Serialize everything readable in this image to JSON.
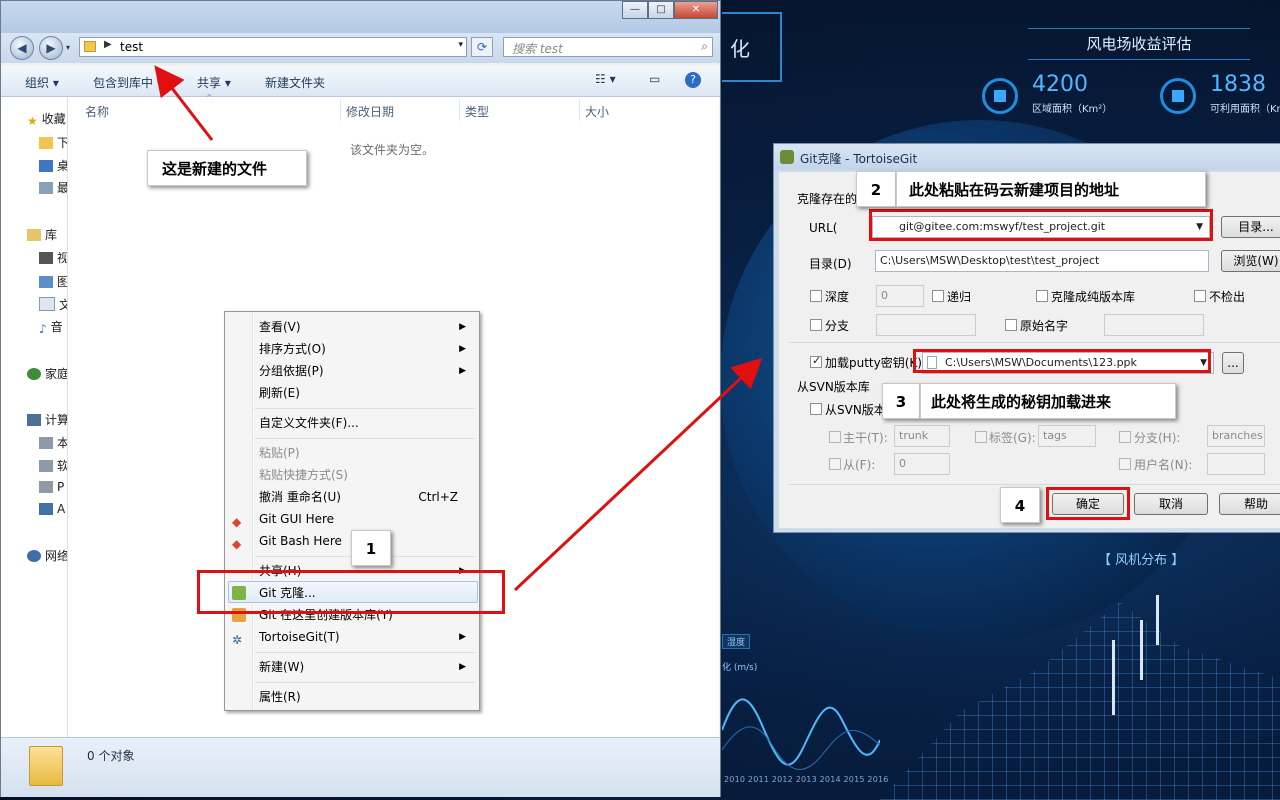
{
  "dashboard": {
    "title": "风电场收益评估",
    "hex_text": "化",
    "stats": [
      {
        "value": "4200",
        "label": "区域面积（Km²）"
      },
      {
        "value": "1838",
        "label": "可利用面积（Km"
      }
    ],
    "fan_label": "【 风机分布 】",
    "wave_tag": "湿度",
    "wave_sub": "化 (m/s)",
    "years": "2010  2011  2012  2013  2014  2015  2016"
  },
  "explorer": {
    "window_buttons": [
      "—",
      "□",
      "✕"
    ],
    "address_crumb": "test",
    "search_placeholder": "搜索 test",
    "toolbar": [
      "组织 ▾",
      "包含到库中 ▾",
      "共享 ▾",
      "新建文件夹"
    ],
    "sidebar": [
      {
        "label": "收藏",
        "icon": "star-icon"
      },
      {
        "label": "下",
        "icon": "download-icon"
      },
      {
        "label": "桌",
        "icon": "desktop-icon"
      },
      {
        "label": "最",
        "icon": "recent-icon"
      },
      {
        "label": "库",
        "icon": "library-icon"
      },
      {
        "label": "视",
        "icon": "video-icon"
      },
      {
        "label": "图",
        "icon": "picture-icon"
      },
      {
        "label": "文",
        "icon": "document-icon"
      },
      {
        "label": "音",
        "icon": "music-icon"
      },
      {
        "label": "家庭",
        "icon": "homegroup-icon"
      },
      {
        "label": "计算",
        "icon": "computer-icon"
      },
      {
        "label": "本",
        "icon": "drive-icon"
      },
      {
        "label": "软",
        "icon": "drive-icon"
      },
      {
        "label": "P",
        "icon": "drive-icon"
      },
      {
        "label": "A",
        "icon": "drive-icon"
      },
      {
        "label": "网络",
        "icon": "network-icon"
      }
    ],
    "columns": [
      "名称",
      "修改日期",
      "类型",
      "大小"
    ],
    "empty_text": "该文件夹为空。",
    "status": "0 个对象"
  },
  "context_menu": {
    "items": [
      {
        "label": "查看(V)",
        "submenu": true
      },
      {
        "label": "排序方式(O)",
        "submenu": true
      },
      {
        "label": "分组依据(P)",
        "submenu": true
      },
      {
        "label": "刷新(E)"
      },
      {
        "label": "自定义文件夹(F)..."
      },
      {
        "label": "粘贴(P)",
        "disabled": true
      },
      {
        "label": "粘贴快捷方式(S)",
        "disabled": true
      },
      {
        "label": "撤消 重命名(U)",
        "shortcut": "Ctrl+Z"
      },
      {
        "label": "Git GUI Here",
        "icon": "git-icon"
      },
      {
        "label": "Git Bash Here",
        "icon": "git-icon"
      },
      {
        "label": "共享(H)",
        "submenu": true
      },
      {
        "label": "Git 克隆...",
        "icon": "git-clone-icon"
      },
      {
        "label": "Git 在这里创建版本库(Y)",
        "icon": "git-repo-icon"
      },
      {
        "label": "TortoiseGit(T)",
        "icon": "tortoise-icon",
        "submenu": true
      },
      {
        "label": "新建(W)",
        "submenu": true
      },
      {
        "label": "属性(R)"
      }
    ]
  },
  "git_dialog": {
    "title": "Git克隆 - TortoiseGit",
    "group_clone": "克隆存在的",
    "url_label": "URL(",
    "url_value": "git@gitee.com:mswyf/test_project.git",
    "dir_btn": "目录...",
    "dir_label": "目录(D)",
    "dir_value": "C:\\Users\\MSW\\Desktop\\test\\test_project",
    "browse_btn": "浏览(W)",
    "depth_label": "深度",
    "depth_value": "0",
    "recursive_label": "递归",
    "bare_label": "克隆成纯版本库",
    "no_checkout_label": "不检出",
    "branch_label": "分支",
    "origin_label": "原始名字",
    "putty_label": "加载putty密钥(K)",
    "putty_value": "C:\\Users\\MSW\\Documents\\123.ppk",
    "putty_browse": "...",
    "svn_group": "从SVN版本库",
    "svn_check": "从SVN版本库",
    "trunk_label": "主干(T):",
    "trunk_value": "trunk",
    "tags_label": "标签(G):",
    "tags_value": "tags",
    "branches_label": "分支(H):",
    "branches_value": "branches",
    "from_label": "从(F):",
    "from_value": "0",
    "username_label": "用户名(N):",
    "ok": "确定",
    "cancel": "取消",
    "help": "帮助"
  },
  "annotations": {
    "new_file_note": "这是新建的文件",
    "step1": "1",
    "step2": "2",
    "step2_text": "此处粘贴在码云新建项目的地址",
    "step3": "3",
    "step3_text": "此处将生成的秘钥加载进来",
    "step4": "4"
  },
  "colors": {
    "annotation_red": "#e01010",
    "dashboard_accent": "#4fb8ff"
  }
}
